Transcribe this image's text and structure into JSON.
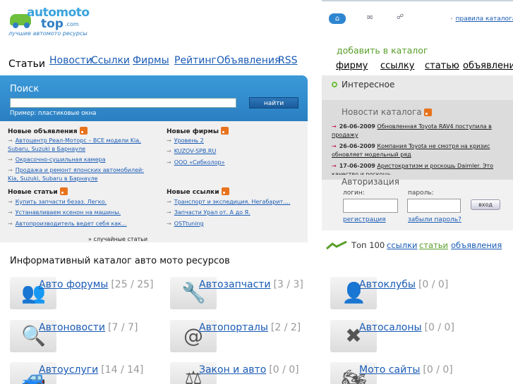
{
  "logo": {
    "word1": "automoto",
    "word2": "top",
    "dotcom": ".com",
    "slogan": "лучшие автомото ресурсы"
  },
  "topbar": {
    "home_icon": "home-icon",
    "mail_icon": "mail-icon",
    "sitemap_icon": "sitemap-icon",
    "rules_link": "правила каталога",
    "arrow": "›"
  },
  "nav": {
    "current": "Статьи",
    "items": [
      "Новости",
      "Ссылки",
      "Фирмы",
      "Рейтинг",
      "Объявления",
      "RSS"
    ]
  },
  "add": {
    "title": "добавить в каталог",
    "links": [
      "фирму",
      "ссылку",
      "статью",
      "объявлени"
    ]
  },
  "search": {
    "title": "Поиск",
    "button": "найти",
    "hint": "Пример: пластиковые окна",
    "value": ""
  },
  "blocks": {
    "ads": {
      "title": "Новые объявления",
      "items": [
        "Автоцентр Реал-Моторс – ВСЕ модели Kia, Subaru, Suzuki в Барнауле",
        "Окрасочно-сушильная камера",
        "Продажа и ремонт японских автомобилей: Kia, Suzuki, Subaru в Барнауле"
      ]
    },
    "firms": {
      "title": "Новые фирмы",
      "items": [
        "Уровень 2",
        "KUZOV-SPB.RU",
        "ООО «Сибколор»"
      ]
    },
    "articles": {
      "title": "Новые статьи",
      "items": [
        "Купить запчасти безаз. Легко.",
        "Устанавливаем ксенон на машины.",
        "Автопроизводитель ведет себя как..."
      ]
    },
    "links": {
      "title": "Новые ссылки",
      "items": [
        "Транспорт и экспедиция. Негабарит....",
        "Запчасти Урал от. А до Я.",
        "OSTtuning"
      ]
    },
    "random": "случайные статьи"
  },
  "right": {
    "interesting": "Интересное",
    "news_title": "Новости каталога",
    "news": [
      {
        "date": "26-06-2009",
        "text": "Обновленная Toyota RAV4 поступила в продажу"
      },
      {
        "date": "26-06-2009",
        "text": "Компания Toyota не смотря на кризис обновляет модельный ряд"
      },
      {
        "date": "17-06-2009",
        "text": "Аристократизм и роскошь Daimler. Это качество и роскошь"
      }
    ],
    "auth": {
      "title": "Авторизация",
      "login": "логин:",
      "password": "пароль:",
      "button": "вход",
      "register": "регистрация",
      "forgot": "забыли пароль?"
    }
  },
  "top100": {
    "label": "Топ 100",
    "links": [
      "ссылки",
      "статьи",
      "объявления"
    ]
  },
  "catalog": {
    "title": "Информативный каталог авто мото ресурсов",
    "items": [
      {
        "name": "Авто форумы",
        "count": "[25 / 25]",
        "icon": "forum-people-icon",
        "glyph": "👥"
      },
      {
        "name": "Автозапчасти",
        "count": "[3 / 3]",
        "icon": "wrench-gear-icon",
        "glyph": "🔧"
      },
      {
        "name": "Автоклубы",
        "count": "[0 / 0]",
        "icon": "club-person-icon",
        "glyph": "👤"
      },
      {
        "name": "Автоновости",
        "count": "[7 / 7]",
        "icon": "magnifier-icon",
        "glyph": "🔍"
      },
      {
        "name": "Автопорталы",
        "count": "[2 / 2]",
        "icon": "tire-at-icon",
        "glyph": "@"
      },
      {
        "name": "Автосалоны",
        "count": "[0 / 0]",
        "icon": "crossed-tools-icon",
        "glyph": "✖"
      },
      {
        "name": "Автоуслуги",
        "count": "[14 / 14]",
        "icon": "car-icon",
        "glyph": "🚙"
      },
      {
        "name": "Закон и авто",
        "count": "[0 / 0]",
        "icon": "scales-icon",
        "glyph": "⚖"
      },
      {
        "name": "Мото сайты",
        "count": "[0 / 0]",
        "icon": "motorcycle-icon",
        "glyph": "🏍"
      }
    ]
  },
  "colors": {
    "accent_blue": "#2f86d0",
    "link": "#1a5bb5",
    "green": "#5a9e2a",
    "rss": "#e8731c"
  }
}
